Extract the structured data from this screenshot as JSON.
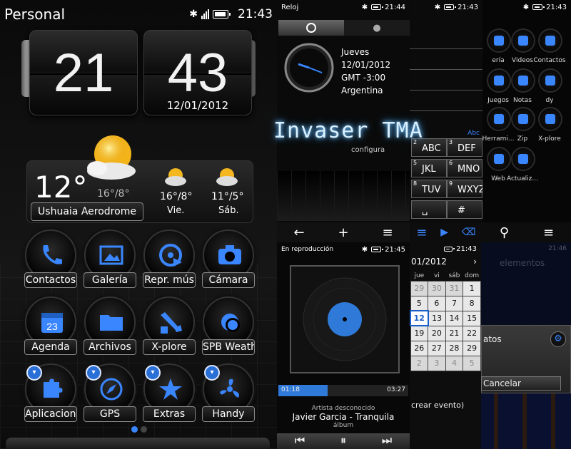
{
  "main": {
    "status": {
      "title": "Personal",
      "time": "21:43"
    },
    "clock": {
      "hour": "21",
      "minute": "43",
      "date": "12/01/2012"
    },
    "weather": {
      "temp": "12°",
      "range": "16°/8°",
      "location": "Ushuaia Aerodrome",
      "forecast": [
        {
          "temps": "16°/8°",
          "day": "Vie."
        },
        {
          "temps": "11°/5°",
          "day": "Sáb."
        }
      ]
    },
    "apps": [
      {
        "label": "Contactos",
        "icon": "phone-icon"
      },
      {
        "label": "Galería",
        "icon": "gallery-icon"
      },
      {
        "label": "Repr. mús",
        "icon": "music-player-icon"
      },
      {
        "label": "Cámara",
        "icon": "camera-icon"
      },
      {
        "label": "Agenda",
        "icon": "calendar-icon",
        "num": "23"
      },
      {
        "label": "Archivos",
        "icon": "folder-icon"
      },
      {
        "label": "X-plore",
        "icon": "tools-icon"
      },
      {
        "label": "SPB Weath",
        "icon": "weather-icon"
      },
      {
        "label": "Aplicacion.",
        "icon": "puzzle-icon"
      },
      {
        "label": "GPS",
        "icon": "compass-icon"
      },
      {
        "label": "Extras",
        "icon": "star-icon"
      },
      {
        "label": "Handy",
        "icon": "fan-icon"
      }
    ]
  },
  "clock_panel": {
    "title": "Reloj",
    "time": "21:44",
    "day": "Jueves",
    "date": "12/01/2012",
    "gmt": "GMT -3:00",
    "country": "Argentina",
    "config": "configura"
  },
  "overlay_title": "Invaser TMA",
  "keypad": {
    "time": "21:43",
    "abc": "Abc",
    "keys": [
      {
        "num": "2",
        "letters": "ABC"
      },
      {
        "num": "3",
        "letters": "DEF"
      },
      {
        "num": "5",
        "letters": "JKL"
      },
      {
        "num": "6",
        "letters": "MNO"
      },
      {
        "num": "8",
        "letters": "TUV"
      },
      {
        "num": "9",
        "letters": "WXYZ"
      },
      {
        "num": "",
        "letters": "␣"
      },
      {
        "num": "",
        "letters": "#"
      }
    ]
  },
  "apps_panel": {
    "time": "21:43",
    "labels": [
      "ería",
      "Videos",
      "Contactos",
      "Juegos",
      "Notas",
      "dy",
      "Herrami...",
      "Zip",
      "X-plore",
      "Web",
      "Actualiz..."
    ]
  },
  "player": {
    "title": "En reproducción",
    "time": "21:45",
    "elapsed": "01:18",
    "total": "03:27",
    "progress": 0.38,
    "artist": "Artista desconocido",
    "track": "Javier Garcia - Tranquila",
    "album": "álbum"
  },
  "calendar": {
    "time": "21:43",
    "month": "01/2012",
    "headers": [
      "jue",
      "vi",
      "sáb",
      "dom"
    ],
    "rows": [
      [
        "29",
        "30",
        "31",
        "1"
      ],
      [
        "5",
        "6",
        "7",
        "8"
      ],
      [
        "12",
        "13",
        "14",
        "15"
      ],
      [
        "19",
        "20",
        "21",
        "22"
      ],
      [
        "26",
        "27",
        "28",
        "29"
      ],
      [
        "2",
        "3",
        "4",
        "5"
      ]
    ],
    "footer": "crear evento)"
  },
  "dialog": {
    "time": "21:46",
    "header": "elementos",
    "row": "atos",
    "cancel": "Cancelar"
  },
  "colors": {
    "accent": "#3a86ff",
    "bg": "#000000"
  }
}
